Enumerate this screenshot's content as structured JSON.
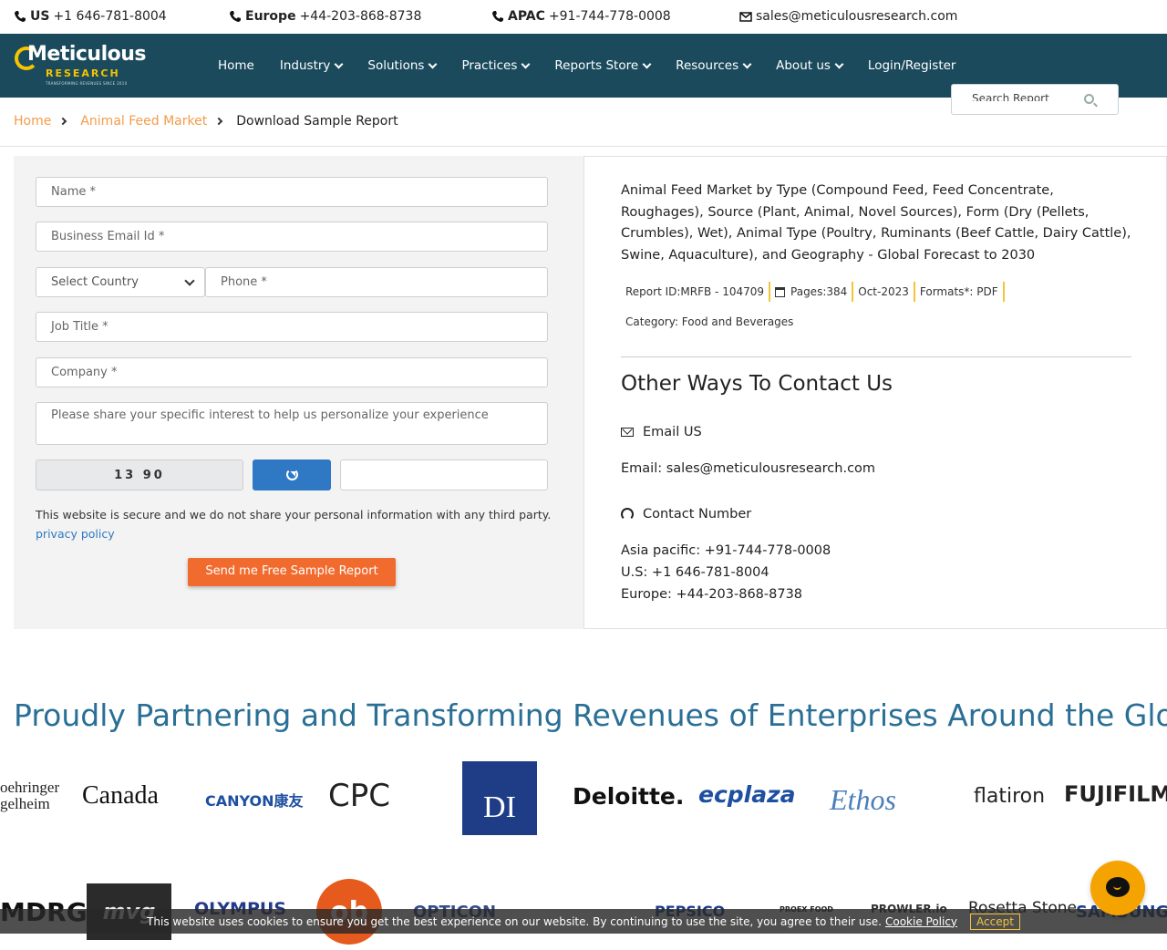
{
  "topbar": {
    "us_label": "US",
    "us_phone": "+1 646-781-8004",
    "eu_label": "Europe",
    "eu_phone": "+44-203-868-8738",
    "apac_label": "APAC",
    "apac_phone": "+91-744-778-0008",
    "email": "sales@meticulousresearch.com"
  },
  "logo": {
    "line1": "Meticulous",
    "line2": "RESEARCH",
    "tagline": "TRANSFORMING REVENUES SINCE 2010"
  },
  "nav": {
    "items": [
      "Home",
      "Industry",
      "Solutions",
      "Practices",
      "Reports Store",
      "Resources",
      "About us",
      "Login/Register"
    ],
    "search_placeholder": "Search Report"
  },
  "breadcrumb": {
    "home": "Home",
    "market": "Animal Feed Market",
    "current": "Download Sample Report"
  },
  "form": {
    "name": "Name *",
    "email": "Business Email Id *",
    "country": "Select Country",
    "phone": "Phone *",
    "job": "Job Title *",
    "company": "Company *",
    "interest": "Please share your specific interest to help us personalize your experience",
    "captcha": "13 90",
    "secure_text": "This website is secure and we do not share your personal information with any third party.",
    "privacy": "privacy policy",
    "submit": "Send me Free Sample Report"
  },
  "report": {
    "title": "Animal Feed Market by Type (Compound Feed, Feed Concentrate, Roughages), Source (Plant, Animal, Novel Sources), Form (Dry (Pellets, Crumbles), Wet), Animal Type (Poultry, Ruminants (Beef Cattle, Dairy Cattle), Swine, Aquaculture), and Geography - Global Forecast to 2030",
    "report_id": "Report ID:MRFB - 104709",
    "pages": "Pages:384",
    "date": "Oct-2023",
    "formats": "Formats*: PDF",
    "category": "Category: Food and Beverages"
  },
  "contact": {
    "heading": "Other Ways To Contact Us",
    "email_heading": "Email US",
    "email_line": "Email: sales@meticulousresearch.com",
    "phone_heading": "Contact Number",
    "asia": "Asia pacific: +91-744-778-0008",
    "us": "U.S: +1 646-781-8004",
    "europe": "Europe: +44-203-868-8738"
  },
  "partners": {
    "title": "Proudly Partnering and Transforming Revenues of Enterprises Around the Globe",
    "row1": [
      "oehringer\ngelheim",
      "Canada",
      "CANYON康友",
      "CPC",
      "DI",
      "Deloitte.",
      "ecplaza",
      "Ethos",
      "flatiron",
      "FUJIFILM"
    ],
    "row2": [
      "MDRG",
      "mvg",
      "OLYMPUS",
      "ob",
      "OPTICON",
      "PEPSICO",
      "PROEX FOOD",
      "PROWLER.io",
      "Rosetta Stone",
      "SAMSUNG"
    ]
  },
  "cookie": {
    "text": "This website uses cookies to ensure you get the best experience on our website. By continuing to use the site, you agree to their use.",
    "policy": "Cookie Policy",
    "accept": "Accept"
  },
  "colors": {
    "nav": "#1a4a5c",
    "accent": "#f26b2e",
    "link": "#2f78c4",
    "partner_title": "#2a6f95"
  }
}
